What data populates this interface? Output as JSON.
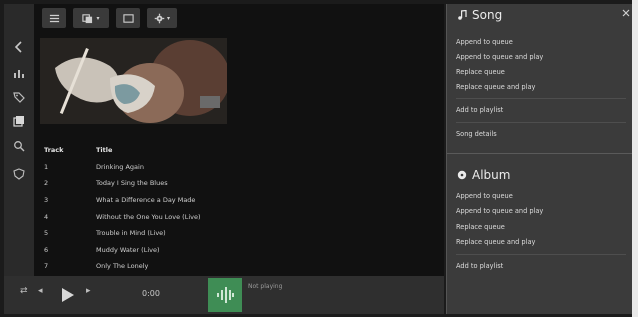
{
  "toolbar": {
    "icons": [
      "list-icon",
      "view-icon",
      "window-icon",
      "gear-icon"
    ]
  },
  "rail": {
    "icons": [
      "back-icon",
      "bars-icon",
      "tag-icon",
      "library-icon",
      "search-icon",
      "shield-icon"
    ]
  },
  "tracks": {
    "header": {
      "track": "Track",
      "title": "Title"
    },
    "rows": [
      {
        "track": "1",
        "title": "Drinking Again"
      },
      {
        "track": "2",
        "title": "Today I Sing the Blues"
      },
      {
        "track": "3",
        "title": "What a Difference a Day Made"
      },
      {
        "track": "4",
        "title": "Without the One You Love (Live)"
      },
      {
        "track": "5",
        "title": "Trouble in Mind (Live)"
      },
      {
        "track": "6",
        "title": "Muddy Water (Live)"
      },
      {
        "track": "7",
        "title": "Only The Lonely"
      }
    ]
  },
  "player": {
    "time": "0:00",
    "now_playing": "Not playing"
  },
  "song_menu": {
    "title": "Song",
    "items": [
      "Append to queue",
      "Append to queue and play",
      "Replace queue",
      "Replace queue and play",
      "Add to playlist",
      "Song details"
    ]
  },
  "album_menu": {
    "title": "Album",
    "items": [
      "Append to queue",
      "Append to queue and play",
      "Replace queue",
      "Replace queue and play",
      "Add to playlist"
    ]
  },
  "colors": {
    "accent": "#3f8d55",
    "panel": "#3b3b3b",
    "background": "#111111"
  }
}
